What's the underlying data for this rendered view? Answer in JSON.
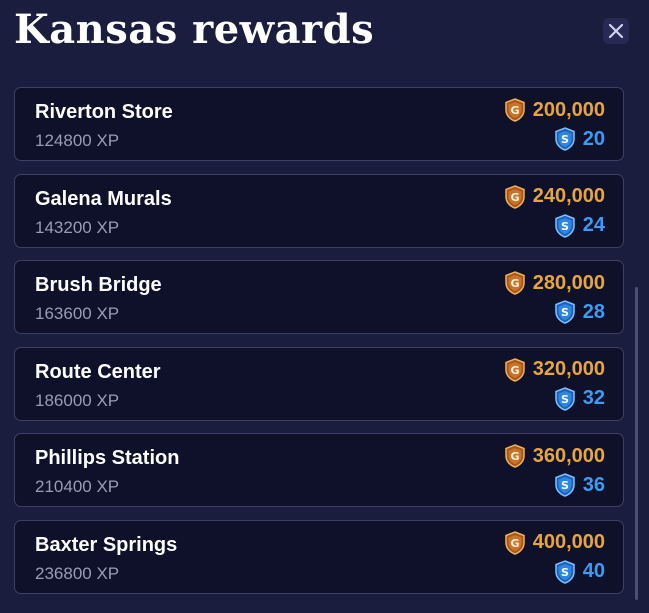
{
  "title": "Kansas rewards",
  "close_icon": "close-icon",
  "currency_icons": {
    "gold": "gold-coin-icon",
    "silver": "silver-coin-icon"
  },
  "colors": {
    "gold": "#e5a63f",
    "silver": "#3b9cf2"
  },
  "rewards": [
    {
      "name": "Riverton Store",
      "xp": "124800 XP",
      "gold": "200,000",
      "silver": "20"
    },
    {
      "name": "Galena Murals",
      "xp": "143200 XP",
      "gold": "240,000",
      "silver": "24"
    },
    {
      "name": "Brush Bridge",
      "xp": "163600 XP",
      "gold": "280,000",
      "silver": "28"
    },
    {
      "name": "Route Center",
      "xp": "186000 XP",
      "gold": "320,000",
      "silver": "32"
    },
    {
      "name": "Phillips Station",
      "xp": "210400 XP",
      "gold": "360,000",
      "silver": "36"
    },
    {
      "name": "Baxter Springs",
      "xp": "236800 XP",
      "gold": "400,000",
      "silver": "40"
    }
  ]
}
